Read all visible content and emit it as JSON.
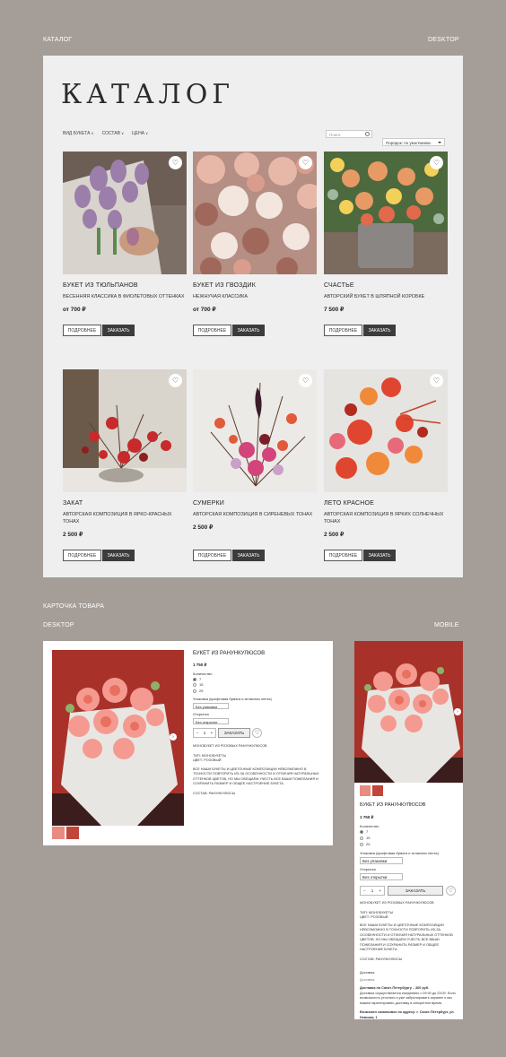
{
  "labels": {
    "catalog": "КАТАЛОГ",
    "desktop": "DESKTOP",
    "product_card": "КАРТОЧКА ТОВАРА",
    "desktop2": "DESKTOP",
    "mobile": "MOBILE"
  },
  "catalog": {
    "title": "КАТАЛОГ",
    "filters": [
      "ВИД БУКЕТА",
      "СОСТАВ",
      "ЦЕНА"
    ],
    "search_placeholder": "Поиск",
    "sort": "Порядок: по умолчанию",
    "btn_more": "ПОДРОБНЕЕ",
    "btn_order": "ЗАКАЗАТЬ",
    "items": [
      {
        "title": "БУКЕТ ИЗ ТЮЛЬПАНОВ",
        "sub": "ВЕСЕННЯЯ КЛАССИКА В ФИОЛЕТОВЫХ ОТТЕНКАХ",
        "price": "от 700 ₽"
      },
      {
        "title": "БУКЕТ ИЗ ГВОЗДИК",
        "sub": "НЕЖНУЧАЯ КЛАССИКА",
        "price": "от 700 ₽"
      },
      {
        "title": "СЧАСТЬЕ",
        "sub": "АВТОРСКИЙ БУКЕТ В ШЛЯПНОЙ КОРОБКЕ",
        "price": "7 500 ₽"
      },
      {
        "title": "ЗАКАТ",
        "sub": "АВТОРСКАЯ КОМПОЗИЦИЯ В ЯРКО-КРАСНЫХ ТОНАХ",
        "price": "2 500 ₽"
      },
      {
        "title": "СУМЕРКИ",
        "sub": "АВТОРСКАЯ КОМПОЗИЦИЯ В СИРЕНЕВЫХ ТОНАХ",
        "price": "2 500 ₽"
      },
      {
        "title": "ЛЕТО КРАСНОЕ",
        "sub": "АВТОРСКАЯ КОМПОЗИЦИЯ В ЯРКИХ СОЛНЕЧНЫХ ТОНАХ",
        "price": "2 500 ₽"
      }
    ]
  },
  "product": {
    "title": "БУКЕТ ИЗ РАНУНКУЛЮСОВ",
    "price": "1 750 ₽",
    "qty_label": "Количество",
    "qty_options": [
      "7",
      "15",
      "25"
    ],
    "wrap_label": "Упаковка (крафтовая бумага и атласная лента)",
    "wrap_value": "Без упаковки",
    "card_label": "Открытка",
    "card_value": "Без открытки",
    "qty_value": "1",
    "order_btn": "ЗАКАЗАТЬ",
    "desc1": "МОНОБУКЕТ ИЗ РОЗОВЫХ РАНУНКУЛЮСОВ",
    "type": "ТИП: МОНОБУКЕТЫ",
    "color": "ЦВЕТ: РОЗОВЫЙ",
    "desc2": "ВСЕ НАШИ БУКЕТЫ И ЦВЕТОЧНЫЕ КОМПОЗИЦИИ НЕВОЗМОЖНО В ТОЧНОСТИ ПОВТОРИТЬ ИЗ-ЗА ОСОБЕННОСТИ И ОТЛИЧИЯ НАТУРАЛЬНЫХ ОТТЕНКОВ ЦВЕТОВ, НО МЫ ОБЕЩАЕМ УЧЕСТЬ ВСЕ ВАШИ ПОЖЕЛАНИЯ И СОХРАНИТЬ РАЗМЕР И ОБЩЕЕ НАСТРОЕНИЕ БУКЕТА.",
    "composition": "СОСТАВ: РАНУНКУЛЮСЫ",
    "delivery_title": "Доставка",
    "delivery_sub": "Доставка",
    "delivery_spb": "Доставка по Санкт-Петербургу – 360 руб.",
    "delivery_text": "Доставка осуществляется ежедневно с 09:00 до 23:00. Если возможность уточнить и уже забронировать заранее и мы можем гарантировать доставку в конкретное время.",
    "pickup": "Возможен самовывоз по адресу: г. Санкт-Петербург, ул. Невская, 1"
  }
}
